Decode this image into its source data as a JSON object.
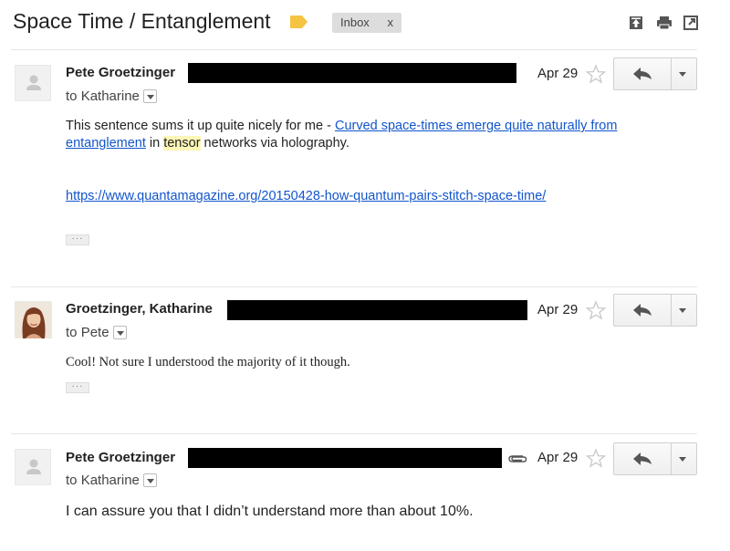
{
  "thread": {
    "subject": "Space Time / Entanglement",
    "label": "Inbox",
    "label_remove": "x"
  },
  "messages": [
    {
      "sender": "Pete Groetzinger",
      "date": "Apr 29",
      "to_prefix": "to",
      "to_name": "Katharine",
      "body_intro": "This sentence sums it up quite nicely for me - ",
      "body_link": "Curved space-times emerge quite naturally from entanglement",
      "body_in": " in ",
      "body_highlight": "tensor",
      "body_rest": " networks via holography.",
      "url": "https://www.quantamagazine.org/20150428-how-quantum-pairs-stitch-space-time/",
      "ellipsis": "···"
    },
    {
      "sender": "Groetzinger, Katharine",
      "date": "Apr 29",
      "to_prefix": "to",
      "to_name": "Pete",
      "body": "Cool! Not sure I understood the majority of it though.",
      "ellipsis": "···"
    },
    {
      "sender": "Pete Groetzinger",
      "date": "Apr 29",
      "to_prefix": "to",
      "to_name": "Katharine",
      "body": "I can assure you that I didn’t understand more than about 10%."
    }
  ],
  "colors": {
    "link": "#1155cc",
    "highlight": "#fdf6b7",
    "label_tag": "#f6c343",
    "chip_bg": "#dddddd"
  },
  "icons": [
    "label-tag-icon",
    "archive-icon",
    "print-icon",
    "new-window-icon",
    "star-icon",
    "reply-icon",
    "dropdown-icon",
    "attachment-icon",
    "avatar-placeholder-icon"
  ]
}
